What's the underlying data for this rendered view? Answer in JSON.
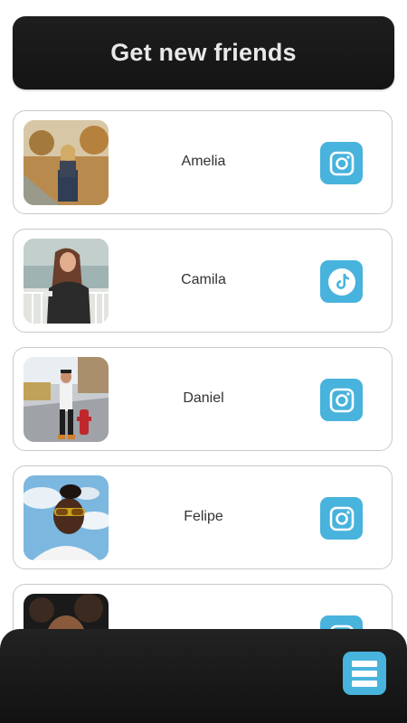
{
  "header": {
    "title": "Get new friends"
  },
  "friends": [
    {
      "name": "Amelia",
      "social": "instagram-icon"
    },
    {
      "name": "Camila",
      "social": "tiktok-icon"
    },
    {
      "name": "Daniel",
      "social": "instagram-icon"
    },
    {
      "name": "Felipe",
      "social": "instagram-icon"
    },
    {
      "name": "",
      "social": "instagram-icon"
    }
  ],
  "bottom_bar": {
    "menu_icon": "menu-icon"
  },
  "colors": {
    "accent": "#48b3dc",
    "header_bg": "#1a1a1a",
    "card_border": "#c9c9c9",
    "text": "#333333"
  }
}
